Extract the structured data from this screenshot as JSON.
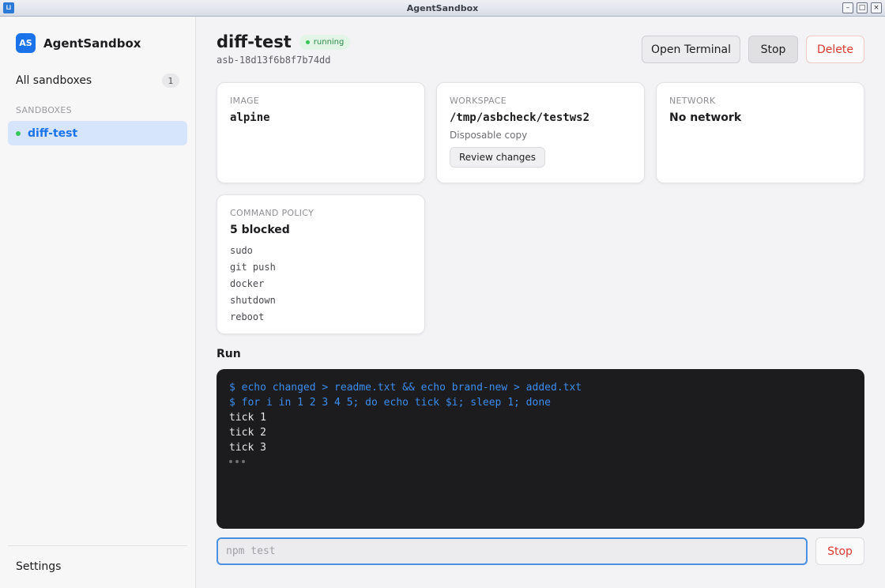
{
  "window": {
    "title": "AgentSandbox"
  },
  "sidebar": {
    "brand_logo": "AS",
    "brand_name": "AgentSandbox",
    "all_label": "All sandboxes",
    "all_count": "1",
    "section_label": "SANDBOXES",
    "items": [
      {
        "label": "diff-test",
        "status_color": "#34c759"
      }
    ],
    "settings_label": "Settings"
  },
  "header": {
    "title": "diff-test",
    "status": "running",
    "sandbox_id": "asb-18d13f6b8f7b74dd",
    "open_terminal": "Open Terminal",
    "stop": "Stop",
    "delete": "Delete"
  },
  "cards": {
    "image": {
      "label": "IMAGE",
      "value": "alpine"
    },
    "workspace": {
      "label": "WORKSPACE",
      "value": "/tmp/asbcheck/testws2",
      "sub": "Disposable copy",
      "button": "Review changes"
    },
    "network": {
      "label": "NETWORK",
      "value": "No network"
    },
    "policy": {
      "label": "COMMAND POLICY",
      "value": "5 blocked",
      "items": [
        "sudo",
        "git push",
        "docker",
        "shutdown",
        "reboot"
      ]
    }
  },
  "run": {
    "heading": "Run",
    "terminal": {
      "commands": [
        "$ echo changed > readme.txt && echo brand-new > added.txt",
        "$ for i in 1 2 3 4 5; do echo tick $i; sleep 1; done"
      ],
      "output": [
        "tick 1",
        "tick 2",
        "tick 3"
      ]
    },
    "input_placeholder": "npm test",
    "stop": "Stop"
  },
  "colors": {
    "accent": "#1a73e8",
    "running": "#34c759",
    "danger": "#d93a2f",
    "terminal_bg": "#1c1c1e",
    "terminal_cmd": "#3b8df0"
  }
}
